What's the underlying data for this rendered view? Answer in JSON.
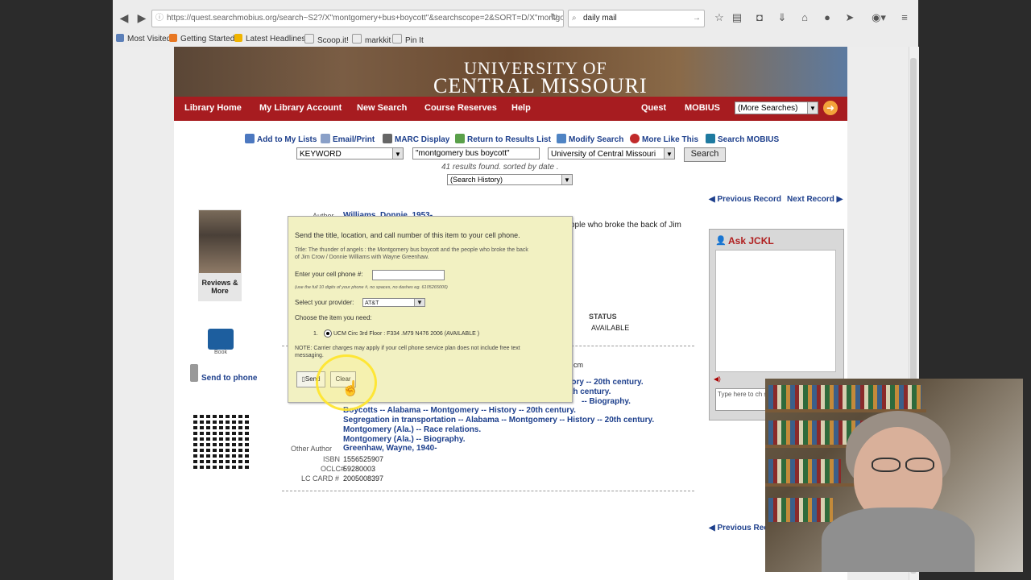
{
  "browser": {
    "url": "https://quest.searchmobius.org/search~S2?/X\"montgomery+bus+boycott\"&searchscope=2&SORT=D/X\"montgomery+bus",
    "search_query": "daily mail",
    "bookmarks": [
      "Most Visited",
      "Getting Started",
      "Latest Headlines",
      "Scoop.it!",
      "markkit",
      "Pin It"
    ]
  },
  "site": {
    "university_line1": "UNIVERSITY OF",
    "university_line2": "CENTRAL MISSOURI"
  },
  "menu": {
    "items": [
      "Library Home",
      "My Library Account",
      "New Search",
      "Course Reserves",
      "Help"
    ],
    "right": [
      "Quest",
      "MOBIUS"
    ],
    "more_searches": "(More Searches)"
  },
  "toolbar": {
    "items": [
      "Add to My Lists",
      "Email/Print",
      "MARC Display",
      "Return to Results List",
      "Modify Search",
      "More Like This",
      "Search MOBIUS"
    ]
  },
  "search": {
    "type": "KEYWORD",
    "query": "\"montgomery bus boycott\"",
    "scope": "University of Central Missouri",
    "button": "Search",
    "results_text": "41 results found. sorted by date .",
    "history": "(Search History)"
  },
  "record": {
    "prev": "Previous Record",
    "next": "Next Record",
    "prev_bottom": "Previous Rec",
    "reviews": "Reviews & More",
    "book_label": "Book",
    "send_to_phone": "Send to phone",
    "author_label": "Author",
    "author": "Williams, Donnie, 1953-",
    "title_tail": "ople who broke the back of Jim",
    "status_label": "STATUS",
    "status_value": "AVAILABLE",
    "extent_tail": "cm",
    "subjects": [
      "tory -- 20th century.",
      "th century.",
      "Boycotts -- Alabama -- Montgomery -- History -- 20th century.",
      "Segregation in transportation -- Alabama -- Montgomery -- History -- 20th century.",
      "Montgomery (Ala.) -- Race relations.",
      "Montgomery (Ala.) -- Biography."
    ],
    "subject_partial": "-- Biography.",
    "other_author_label": "Other Author",
    "other_author": "Greenhaw, Wayne, 1940-",
    "isbn_label": "ISBN",
    "isbn": "1556525907",
    "oclc_label": "OCLC#",
    "oclc": "59280003",
    "lccard_label": "LC CARD #",
    "lccard": "2005008397"
  },
  "ask": {
    "title": "Ask JCKL",
    "placeholder": "Type here to ch send."
  },
  "dialog": {
    "intro": "Send the title, location, and call number of this item to your cell phone.",
    "title_line1": "Title: The thunder of angels : the Montgomery bus boycott and the people who broke the back",
    "title_line2": "of Jim Crow / Donnie Williams with Wayne Greenhaw.",
    "phone_label": "Enter your cell phone #:",
    "phone_hint": "(use the full 10 digits of your phone #, no spaces, no dashes eg. 6105265000)",
    "provider_label": "Select your provider:",
    "provider_value": "AT&T",
    "choose_label": "Choose the item you need:",
    "item_number": "1.",
    "item": "UCM Circ 3rd Floor : F334 .M79 N476 2006 (AVAILABLE )",
    "note_line1": "NOTE: Carrier charges may apply if your cell phone service plan does not include free text",
    "note_line2": "messaging.",
    "send": "Send",
    "clear": "Clear"
  },
  "colors": {
    "menu_bar": "#a71c20",
    "link": "#1d3f8c",
    "dialog_bg": "#f2f1c2"
  }
}
